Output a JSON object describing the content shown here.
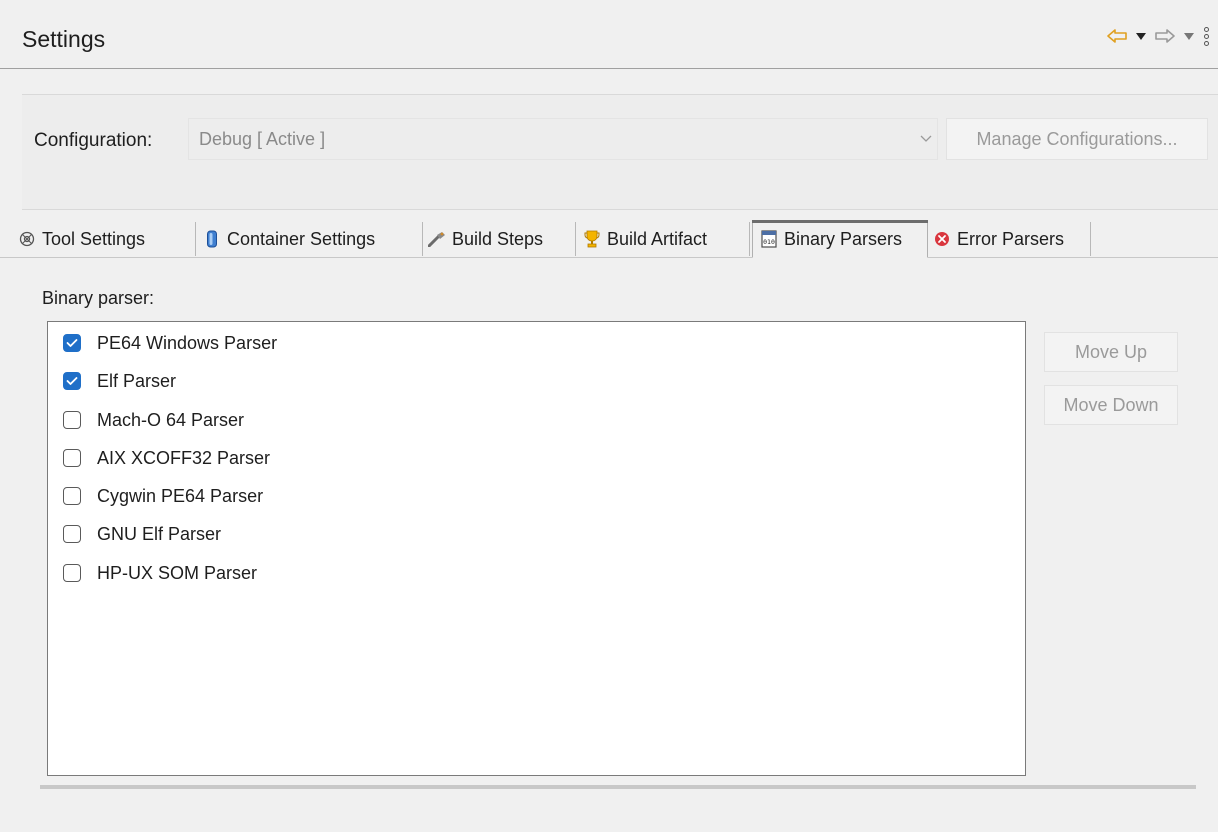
{
  "header": {
    "title": "Settings",
    "nav": {
      "back_icon": "back-arrow-icon",
      "forward_icon": "forward-arrow-icon",
      "menu_icon": "kebab-menu-icon"
    }
  },
  "config": {
    "label": "Configuration:",
    "selected": "Debug  [ Active ]",
    "manage_label": "Manage Configurations..."
  },
  "tabs": [
    {
      "label": "Tool Settings",
      "icon": "gear-icon"
    },
    {
      "label": "Container Settings",
      "icon": "container-icon"
    },
    {
      "label": "Build Steps",
      "icon": "build-steps-icon"
    },
    {
      "label": "Build Artifact",
      "icon": "trophy-icon"
    },
    {
      "label": "Binary Parsers",
      "icon": "binary-file-icon",
      "active": true
    },
    {
      "label": "Error Parsers",
      "icon": "error-icon"
    }
  ],
  "binary": {
    "label": "Binary parser:",
    "parsers": [
      {
        "label": "PE64 Windows Parser",
        "checked": true
      },
      {
        "label": "Elf Parser",
        "checked": true
      },
      {
        "label": "Mach-O 64 Parser",
        "checked": false
      },
      {
        "label": "AIX XCOFF32 Parser",
        "checked": false
      },
      {
        "label": "Cygwin PE64 Parser",
        "checked": false
      },
      {
        "label": "GNU Elf Parser",
        "checked": false
      },
      {
        "label": "HP-UX SOM Parser",
        "checked": false
      }
    ],
    "move_up_label": "Move Up",
    "move_down_label": "Move Down"
  },
  "colors": {
    "accent": "#1f6fc8",
    "back_arrow": "#e0a020",
    "error_red": "#d9363e"
  }
}
